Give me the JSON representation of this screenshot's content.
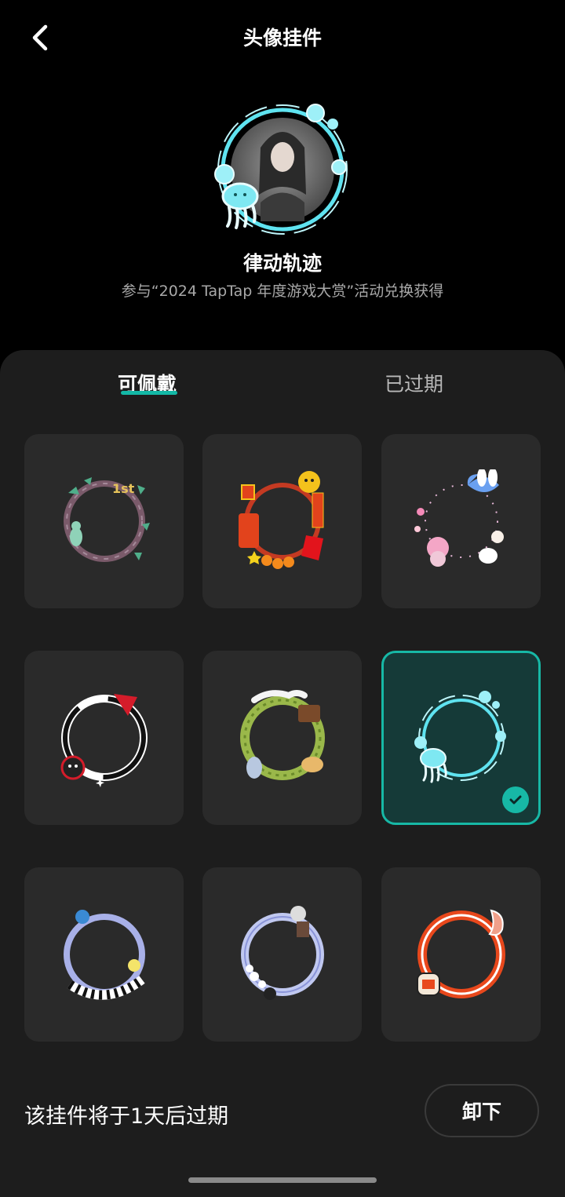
{
  "header": {
    "title": "头像挂件",
    "back_icon": "chevron-left-icon"
  },
  "current": {
    "name": "律动轨迹",
    "description": "参与“2024 TapTap 年度游戏大赏”活动兑换获得"
  },
  "tabs": [
    {
      "label": "可佩戴",
      "active": true
    },
    {
      "label": "已过期",
      "active": false
    }
  ],
  "frames": [
    {
      "icon": "vine-wreath-frame-icon",
      "selected": false
    },
    {
      "icon": "new-year-firecracker-frame-icon",
      "selected": false
    },
    {
      "icon": "bunny-bow-frame-icon",
      "selected": false
    },
    {
      "icon": "black-white-ring-frame-icon",
      "selected": false
    },
    {
      "icon": "forest-wreath-frame-icon",
      "selected": false
    },
    {
      "icon": "jellyfish-bubble-frame-icon",
      "selected": true
    },
    {
      "icon": "piano-key-frame-icon",
      "selected": false
    },
    {
      "icon": "lavender-flower-frame-icon",
      "selected": false
    },
    {
      "icon": "zero-orange-ring-frame-icon",
      "selected": false
    }
  ],
  "footer": {
    "expiry_text": "该挂件将于1天后过期",
    "unequip_label": "卸下"
  },
  "colors": {
    "accent": "#17b8a6",
    "panel": "#1d1d1d",
    "cell": "#2a2a2a",
    "selected_cell": "#153a38"
  }
}
